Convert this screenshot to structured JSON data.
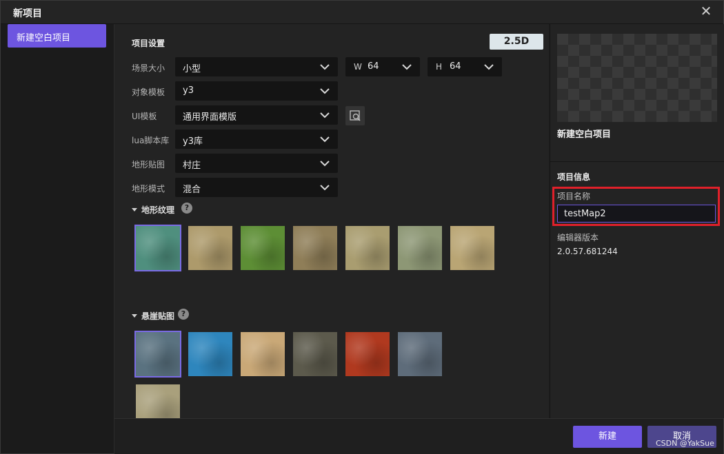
{
  "window": {
    "title": "新项目"
  },
  "left_nav": {
    "items": [
      {
        "label": "新建空白项目"
      }
    ]
  },
  "settings": {
    "title": "项目设置",
    "dimension_badge": "2.5D",
    "scene_size": {
      "label": "场景大小",
      "value": "小型",
      "width_prefix": "W",
      "width": "64",
      "height_prefix": "H",
      "height": "64"
    },
    "object_template": {
      "label": "对象模板",
      "value": "y3"
    },
    "ui_template": {
      "label": "UI模板",
      "value": "通用界面模版"
    },
    "lua_library": {
      "label": "lua脚本库",
      "value": "y3库"
    },
    "terrain_texture_map": {
      "label": "地形贴图",
      "value": "村庄"
    },
    "terrain_mode": {
      "label": "地形模式",
      "value": "混合"
    }
  },
  "terrain_textures": {
    "title": "地形纹理",
    "help": "?",
    "selected_index": 0,
    "colors": [
      "#4f8f7e",
      "#ad9a6b",
      "#5d8e35",
      "#8f7e58",
      "#a99d70",
      "#8d9775",
      "#b9a574"
    ]
  },
  "cliff_textures": {
    "title": "悬崖贴图",
    "help": "?",
    "selected_index": 0,
    "colors": [
      "#5a7280",
      "#2e86bd",
      "#c9a877",
      "#5c5a4c",
      "#b0391f",
      "#5e6c7a",
      "#a9a07c"
    ]
  },
  "preview": {
    "name": "新建空白项目"
  },
  "project_info": {
    "title": "项目信息",
    "name_label": "项目名称",
    "name_value": "testMap2",
    "version_label": "编辑器版本",
    "version_value": "2.0.57.681244"
  },
  "footer": {
    "create_label": "新建",
    "cancel_label": "取消",
    "watermark": "CSDN @YakSue"
  },
  "colors": {
    "accent": "#6d55e0",
    "highlight": "#e0202a"
  }
}
